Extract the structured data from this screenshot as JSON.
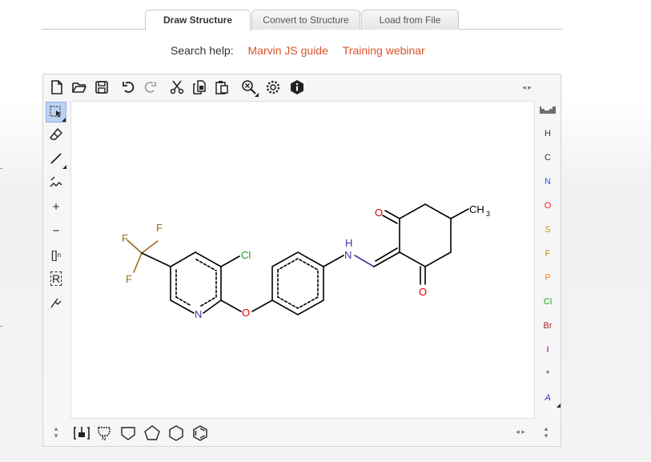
{
  "tabs": [
    {
      "label": "Draw Structure",
      "active": true
    },
    {
      "label": "Convert to Structure",
      "active": false
    },
    {
      "label": "Load from File",
      "active": false
    }
  ],
  "help": {
    "label": "Search help:",
    "links": [
      "Marvin JS guide",
      "Training webinar"
    ]
  },
  "toolbar": {
    "icons": [
      "new-document-icon",
      "open-folder-icon",
      "save-icon",
      "undo-icon",
      "redo-icon",
      "cut-icon",
      "copy-icon",
      "paste-icon",
      "zoom-icon",
      "settings-icon",
      "info-icon"
    ]
  },
  "left_tools": {
    "plus_label": "+",
    "minus_label": "−",
    "bracket_label": "[]",
    "bracket_sub": "n",
    "rgroup_label": "R"
  },
  "elements": [
    "H",
    "C",
    "N",
    "O",
    "S",
    "F",
    "P",
    "Cl",
    "Br",
    "I",
    "*",
    "A"
  ],
  "element_colors": {
    "H": "#333333",
    "C": "#333333",
    "N": "#3050f8",
    "O": "#ff0d0d",
    "S": "#b8a000",
    "F": "#b8860b",
    "P": "#ff8000",
    "Cl": "#1fa01f",
    "Br": "#a62929",
    "I": "#940094",
    "*": "#333333",
    "A": "#3030c0"
  },
  "molecule": {
    "atom_labels": {
      "F1": "F",
      "F2": "F",
      "F3": "F",
      "Cl": "Cl",
      "N_ring": "N",
      "O_ether": "O",
      "H": "H",
      "N_amine": "N",
      "O_top": "O",
      "O_bottom": "O",
      "CH3_main": "CH",
      "CH3_sub": "3"
    },
    "colors": {
      "bond": "#000000",
      "F": "#9a6b1a",
      "Cl": "#1f9a1f",
      "N": "#3a3aa0",
      "O": "#e00000"
    }
  },
  "bottom_tools": {
    "icons": [
      "template-library-icon",
      "sugar-template-icon",
      "cyclopentane-template-icon",
      "pentagon-template-icon",
      "hexagon-template-icon",
      "benzene-template-icon"
    ]
  }
}
